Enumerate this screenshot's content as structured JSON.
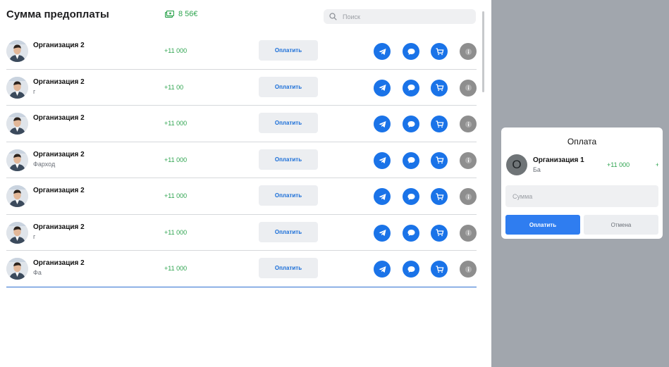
{
  "header": {
    "title": "Сумма предоплаты",
    "balance": "8 56€",
    "search_placeholder": "Поиск"
  },
  "rows": [
    {
      "org": "Организация 2",
      "sub": "",
      "amount": "+11 000",
      "pay_label": "Оплатить"
    },
    {
      "org": "Организация 2",
      "sub": "г",
      "amount": "+11 00",
      "pay_label": "Оплатить"
    },
    {
      "org": "Организация 2",
      "sub": "",
      "amount": "+11 000",
      "pay_label": "Оплатить"
    },
    {
      "org": "Организация 2",
      "sub": "Фарход",
      "amount": "+11 000",
      "pay_label": "Оплатить"
    },
    {
      "org": "Организация 2",
      "sub": "",
      "amount": "+11 000",
      "pay_label": "Оплатить"
    },
    {
      "org": "Организация 2",
      "sub": "г",
      "amount": "+11 000",
      "pay_label": "Оплатить"
    },
    {
      "org": "Организация 2",
      "sub": "Фа",
      "amount": "+11 000",
      "pay_label": "Оплатить"
    }
  ],
  "modal": {
    "title": "Оплата",
    "avatar_letter": "О",
    "org": "Организация 1",
    "sub": "Ба",
    "amount": "+11 000",
    "amount_secondary": "+",
    "sum_placeholder": "Сумма",
    "pay_label": "Оплатить",
    "cancel_label": "Отмена"
  },
  "icons": [
    "money-icon",
    "search-icon",
    "telegram-icon",
    "chat-icon",
    "cart-icon",
    "info-icon"
  ],
  "colors": {
    "accent_blue": "#1a73e8",
    "amount_green": "#2ea44f",
    "overlay_gray": "#a1a6ad",
    "info_gray": "#8e8e8e"
  }
}
